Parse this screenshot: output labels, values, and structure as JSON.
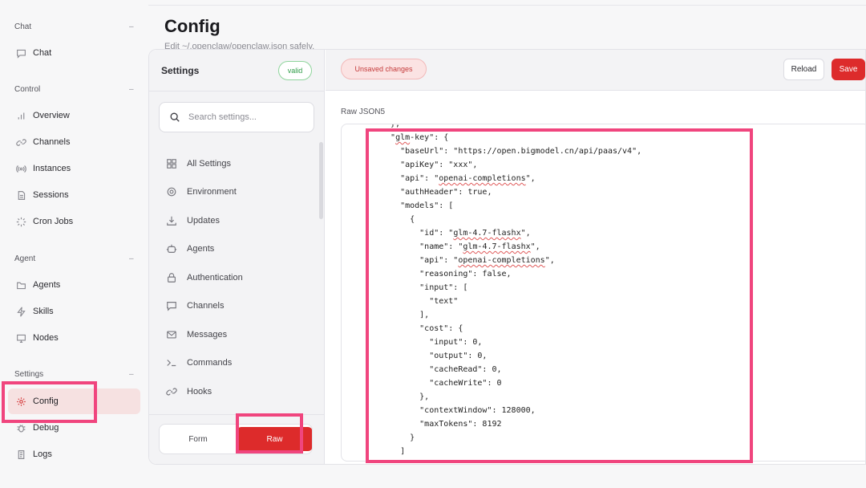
{
  "nav": {
    "groups": [
      {
        "label": "Chat",
        "items": [
          {
            "label": "Chat",
            "icon": "chat-bubble-icon"
          }
        ]
      },
      {
        "label": "Control",
        "items": [
          {
            "label": "Overview",
            "icon": "bar-chart-icon"
          },
          {
            "label": "Channels",
            "icon": "link-icon"
          },
          {
            "label": "Instances",
            "icon": "radio-icon"
          },
          {
            "label": "Sessions",
            "icon": "document-icon"
          },
          {
            "label": "Cron Jobs",
            "icon": "loader-icon"
          }
        ]
      },
      {
        "label": "Agent",
        "items": [
          {
            "label": "Agents",
            "icon": "folder-icon"
          },
          {
            "label": "Skills",
            "icon": "lightning-icon"
          },
          {
            "label": "Nodes",
            "icon": "monitor-icon"
          }
        ]
      },
      {
        "label": "Settings",
        "items": [
          {
            "label": "Config",
            "icon": "gear-icon"
          },
          {
            "label": "Debug",
            "icon": "bug-icon"
          },
          {
            "label": "Logs",
            "icon": "scroll-icon"
          }
        ]
      }
    ],
    "collapse_glyph": "–"
  },
  "page": {
    "title": "Config",
    "subtitle": "Edit ~/.openclaw/openclaw.json safely."
  },
  "settings": {
    "title": "Settings",
    "badge": "valid",
    "search_placeholder": "Search settings...",
    "items": [
      {
        "label": "All Settings",
        "icon": "grid-icon"
      },
      {
        "label": "Environment",
        "icon": "gear-icon"
      },
      {
        "label": "Updates",
        "icon": "download-icon"
      },
      {
        "label": "Agents",
        "icon": "robot-icon"
      },
      {
        "label": "Authentication",
        "icon": "lock-icon"
      },
      {
        "label": "Channels",
        "icon": "chat-bubble-icon"
      },
      {
        "label": "Messages",
        "icon": "mail-icon"
      },
      {
        "label": "Commands",
        "icon": "terminal-icon"
      },
      {
        "label": "Hooks",
        "icon": "link-icon"
      }
    ],
    "mode": {
      "form_label": "Form",
      "raw_label": "Raw",
      "active": "Raw"
    }
  },
  "toolbar": {
    "unsaved_label": "Unsaved changes",
    "reload_label": "Reload",
    "save_label": "Save"
  },
  "editor": {
    "label": "Raw JSON5",
    "lines": [
      "  },",
      "  \"glm-key\": {",
      "    \"baseUrl\": \"https://open.bigmodel.cn/api/paas/v4\",",
      "    \"apiKey\": \"xxx\",",
      "    \"api\": \"openai-completions\",",
      "    \"authHeader\": true,",
      "    \"models\": [",
      "      {",
      "        \"id\": \"glm-4.7-flashx\",",
      "        \"name\": \"glm-4.7-flashx\",",
      "        \"api\": \"openai-completions\",",
      "        \"reasoning\": false,",
      "        \"input\": [",
      "          \"text\"",
      "        ],",
      "        \"cost\": {",
      "          \"input\": 0,",
      "          \"output\": 0,",
      "          \"cacheRead\": 0,",
      "          \"cacheWrite\": 0",
      "        },",
      "        \"contextWindow\": 128000,",
      "        \"maxTokens\": 8192",
      "      }",
      "    ]"
    ]
  },
  "colors": {
    "accent": "#dd2b2b",
    "highlight": "#f0457e",
    "valid": "#2e9c47"
  }
}
